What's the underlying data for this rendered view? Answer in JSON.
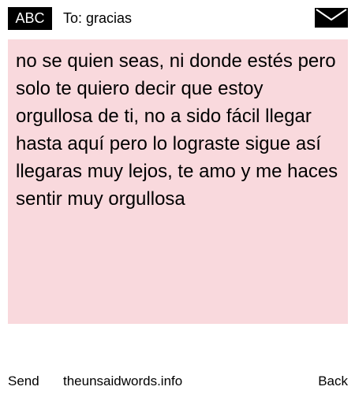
{
  "header": {
    "badge_label": "ABC",
    "recipient_label": "To: gracias",
    "envelope_icon": "envelope-icon"
  },
  "message": {
    "text": "no se quien seas, ni donde estés pero solo te quiero decir que estoy orgullosa de ti, no a sido fácil llegar hasta aquí pero lo lograste sigue así llegaras muy lejos, te amo y me haces sentir muy orgullosa",
    "card_color": "#f9d9dd"
  },
  "footer": {
    "send_label": "Send",
    "site_label": "theunsaidwords.info",
    "back_label": "Back"
  }
}
